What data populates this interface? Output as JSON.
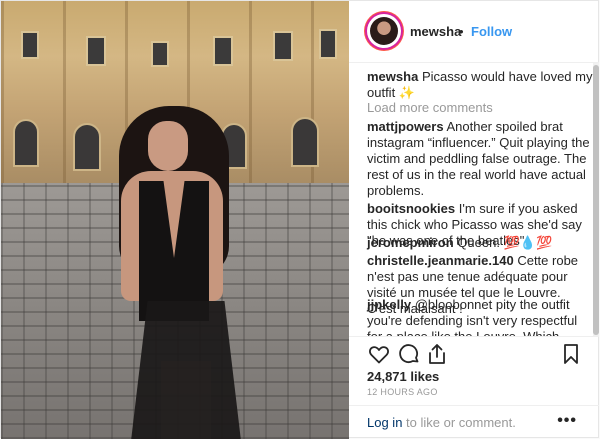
{
  "header": {
    "username": "mewsha",
    "separator": "•",
    "follow_label": "Follow"
  },
  "caption": {
    "username": "mewsha",
    "text": "Picasso would have loved my outfit ✨"
  },
  "load_more_label": "Load more comments",
  "comments": [
    {
      "username": "mattjpowers",
      "text": "Another spoiled brat instagram “influencer.” Quit playing the victim and peddling false outrage. The rest of us in the real world have actual problems."
    },
    {
      "username": "booitsnookies",
      "text": "I'm sure if you asked this chick who Picasso was she'd say \"he was one of the beatles\""
    },
    {
      "username": "jeromepmiron",
      "text": "Queen. 💯💧💯"
    },
    {
      "username": "christelle.jeanmarie.140",
      "text": "Cette robe n'est pas une tenue adéquate pour visité un musée tel que le Louvre. C'est malaisant !"
    },
    {
      "username": "jjpkelly",
      "text": "@bloobonnet pity the outfit you're defending isn't very respectful for a place like the Louvre. Which disproves you."
    }
  ],
  "likes": "24,871 likes",
  "timestamp": "12 HOURS AGO",
  "footer": {
    "login_link": "Log in",
    "login_rest": " to like or comment.",
    "more_label": "•••"
  },
  "icons": [
    "heart-icon",
    "comment-icon",
    "share-icon",
    "bookmark-icon"
  ],
  "colors": {
    "accent": "#3897f0",
    "muted": "#999999",
    "border": "#efefef"
  }
}
